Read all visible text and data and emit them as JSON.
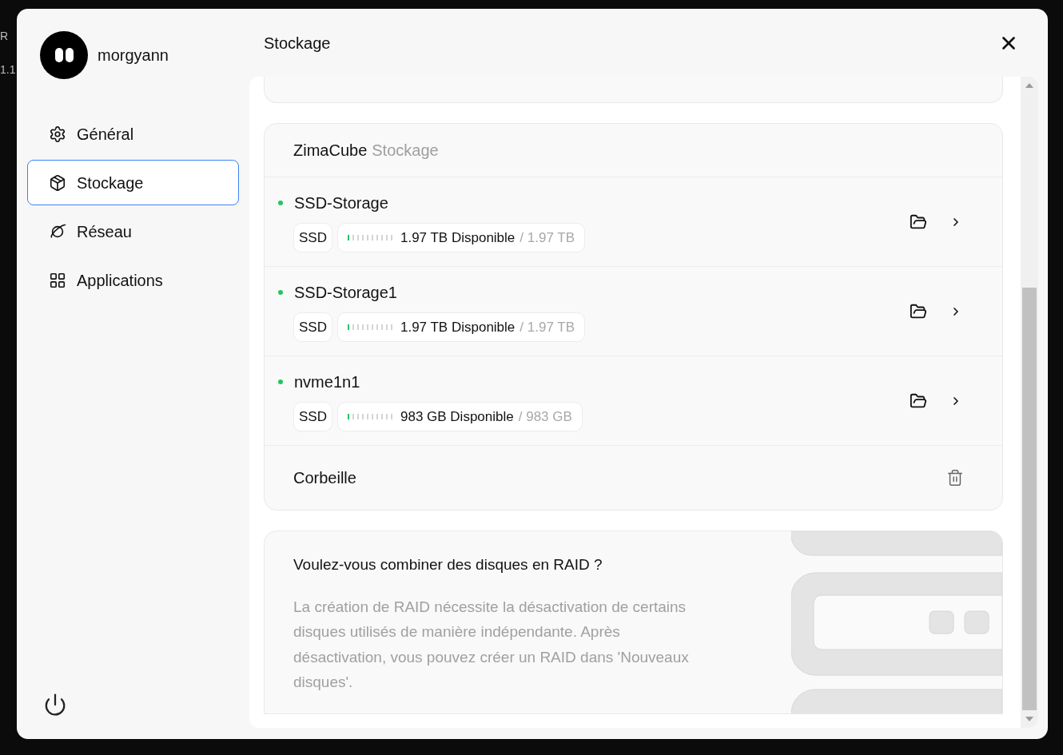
{
  "background_fragments": [
    "R",
    "1.1"
  ],
  "user": {
    "name": "morgyann"
  },
  "sidebar": {
    "items": [
      {
        "label": "Général",
        "kind": "general",
        "selected": false
      },
      {
        "label": "Stockage",
        "kind": "storage",
        "selected": true
      },
      {
        "label": "Réseau",
        "kind": "network",
        "selected": false
      },
      {
        "label": "Applications",
        "kind": "apps",
        "selected": false
      }
    ]
  },
  "header": {
    "title": "Stockage"
  },
  "storage_card": {
    "title": "ZimaCube",
    "subtitle": "Stockage",
    "disks": [
      {
        "name": "SSD-Storage",
        "color": "#22c55e",
        "type": "SSD",
        "level": 0.1,
        "available": "1.97 TB Disponible",
        "total": "/ 1.97 TB"
      },
      {
        "name": "SSD-Storage1",
        "color": "#22c55e",
        "type": "SSD",
        "level": 0.1,
        "available": "1.97 TB Disponible",
        "total": "/ 1.97 TB"
      },
      {
        "name": "nvme1n1",
        "color": "#22c55e",
        "type": "SSD",
        "level": 0.1,
        "available": "983 GB Disponible",
        "total": "/ 983 GB"
      }
    ],
    "trash": {
      "label": "Corbeille"
    }
  },
  "raid_card": {
    "title": "Voulez-vous combiner des disques en RAID ?",
    "description": "La création de RAID nécessite la désactivation de certains disques utilisés de manière indépendante. Après désactivation, vous pouvez créer un RAID dans 'Nouveaux disques'."
  }
}
